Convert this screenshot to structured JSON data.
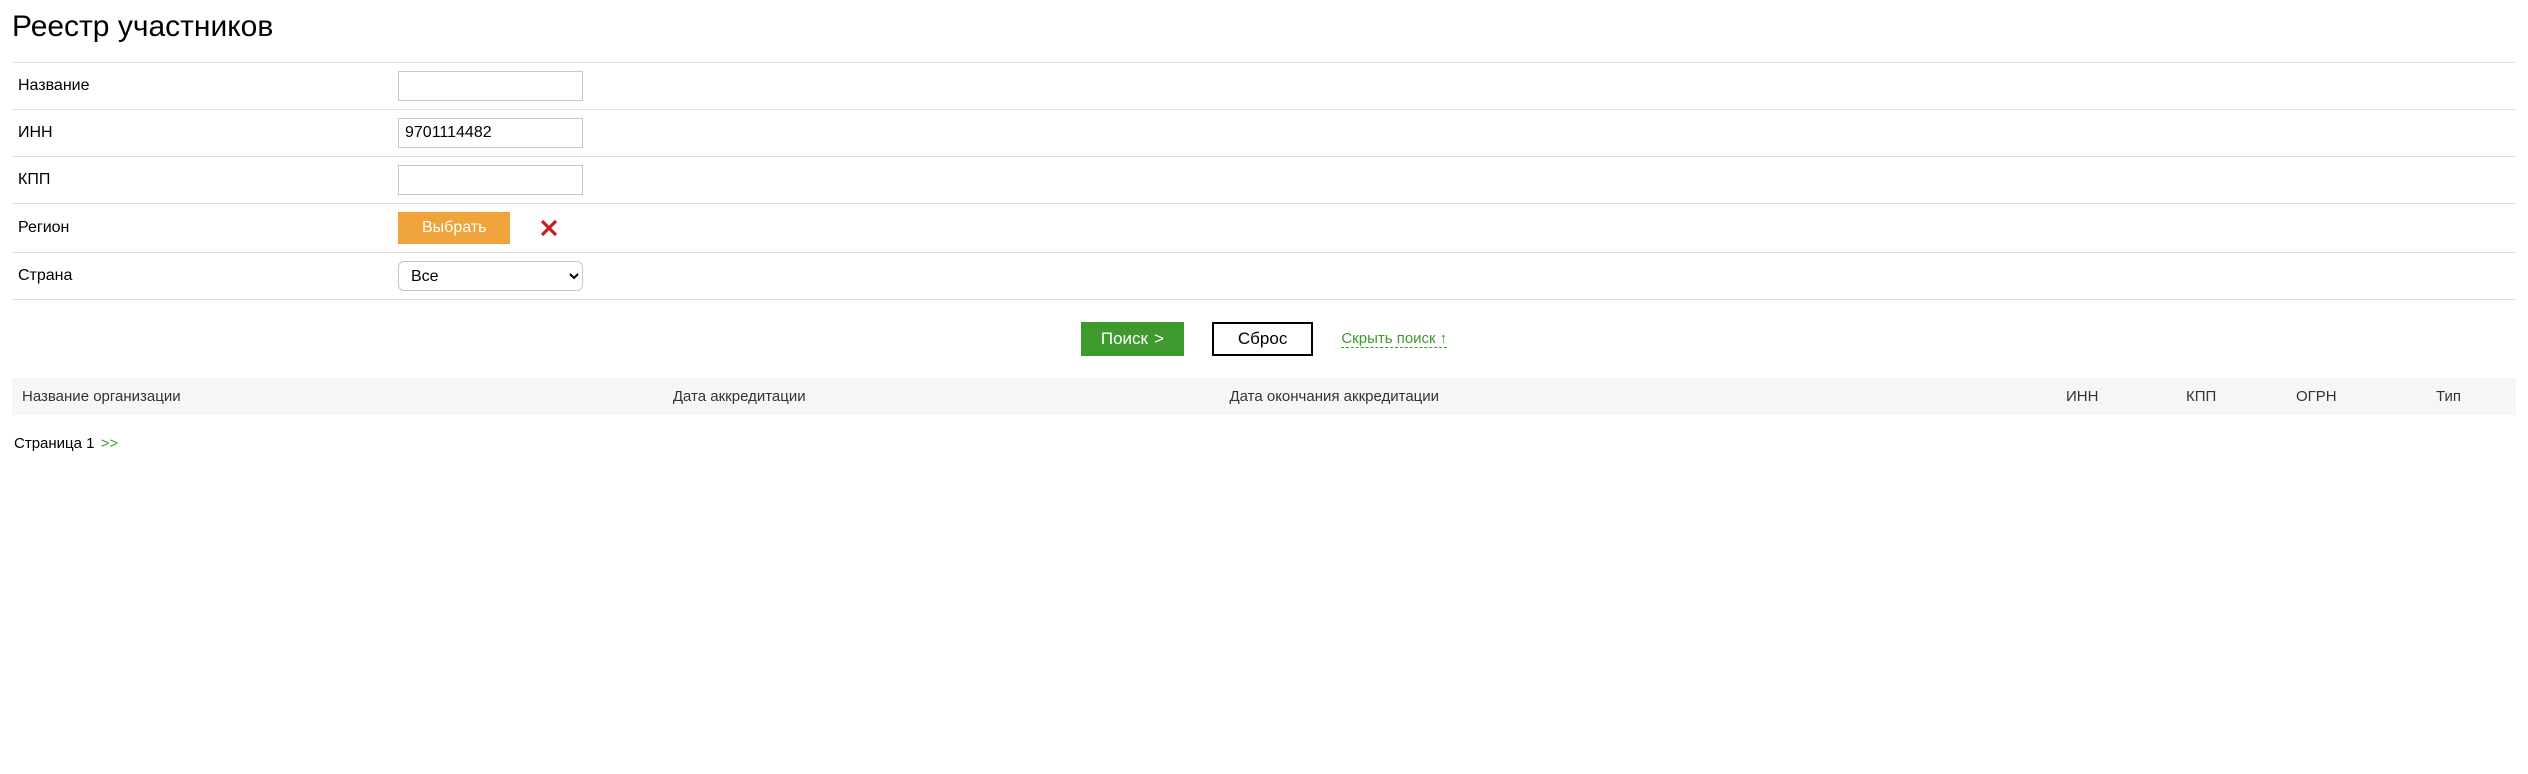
{
  "pageTitle": "Реестр участников",
  "filters": {
    "name": {
      "label": "Название",
      "value": ""
    },
    "inn": {
      "label": "ИНН",
      "value": "9701114482"
    },
    "kpp": {
      "label": "КПП",
      "value": ""
    },
    "region": {
      "label": "Регион",
      "selectButton": "Выбрать"
    },
    "country": {
      "label": "Страна",
      "selected": "Все",
      "options": [
        "Все"
      ]
    }
  },
  "actions": {
    "search": "Поиск",
    "searchChevron": ">",
    "reset": "Сброс",
    "hideSearch": "Скрыть поиск",
    "hideSearchArrow": "↑"
  },
  "table": {
    "headers": {
      "orgName": "Название организации",
      "accredDate": "Дата аккредитации",
      "accredEnd": "Дата окончания аккредитации",
      "inn": "ИНН",
      "kpp": "КПП",
      "ogrn": "ОГРН",
      "type": "Тип"
    },
    "rows": []
  },
  "pagination": {
    "pageLabel": "Страница 1",
    "next": ">>"
  }
}
